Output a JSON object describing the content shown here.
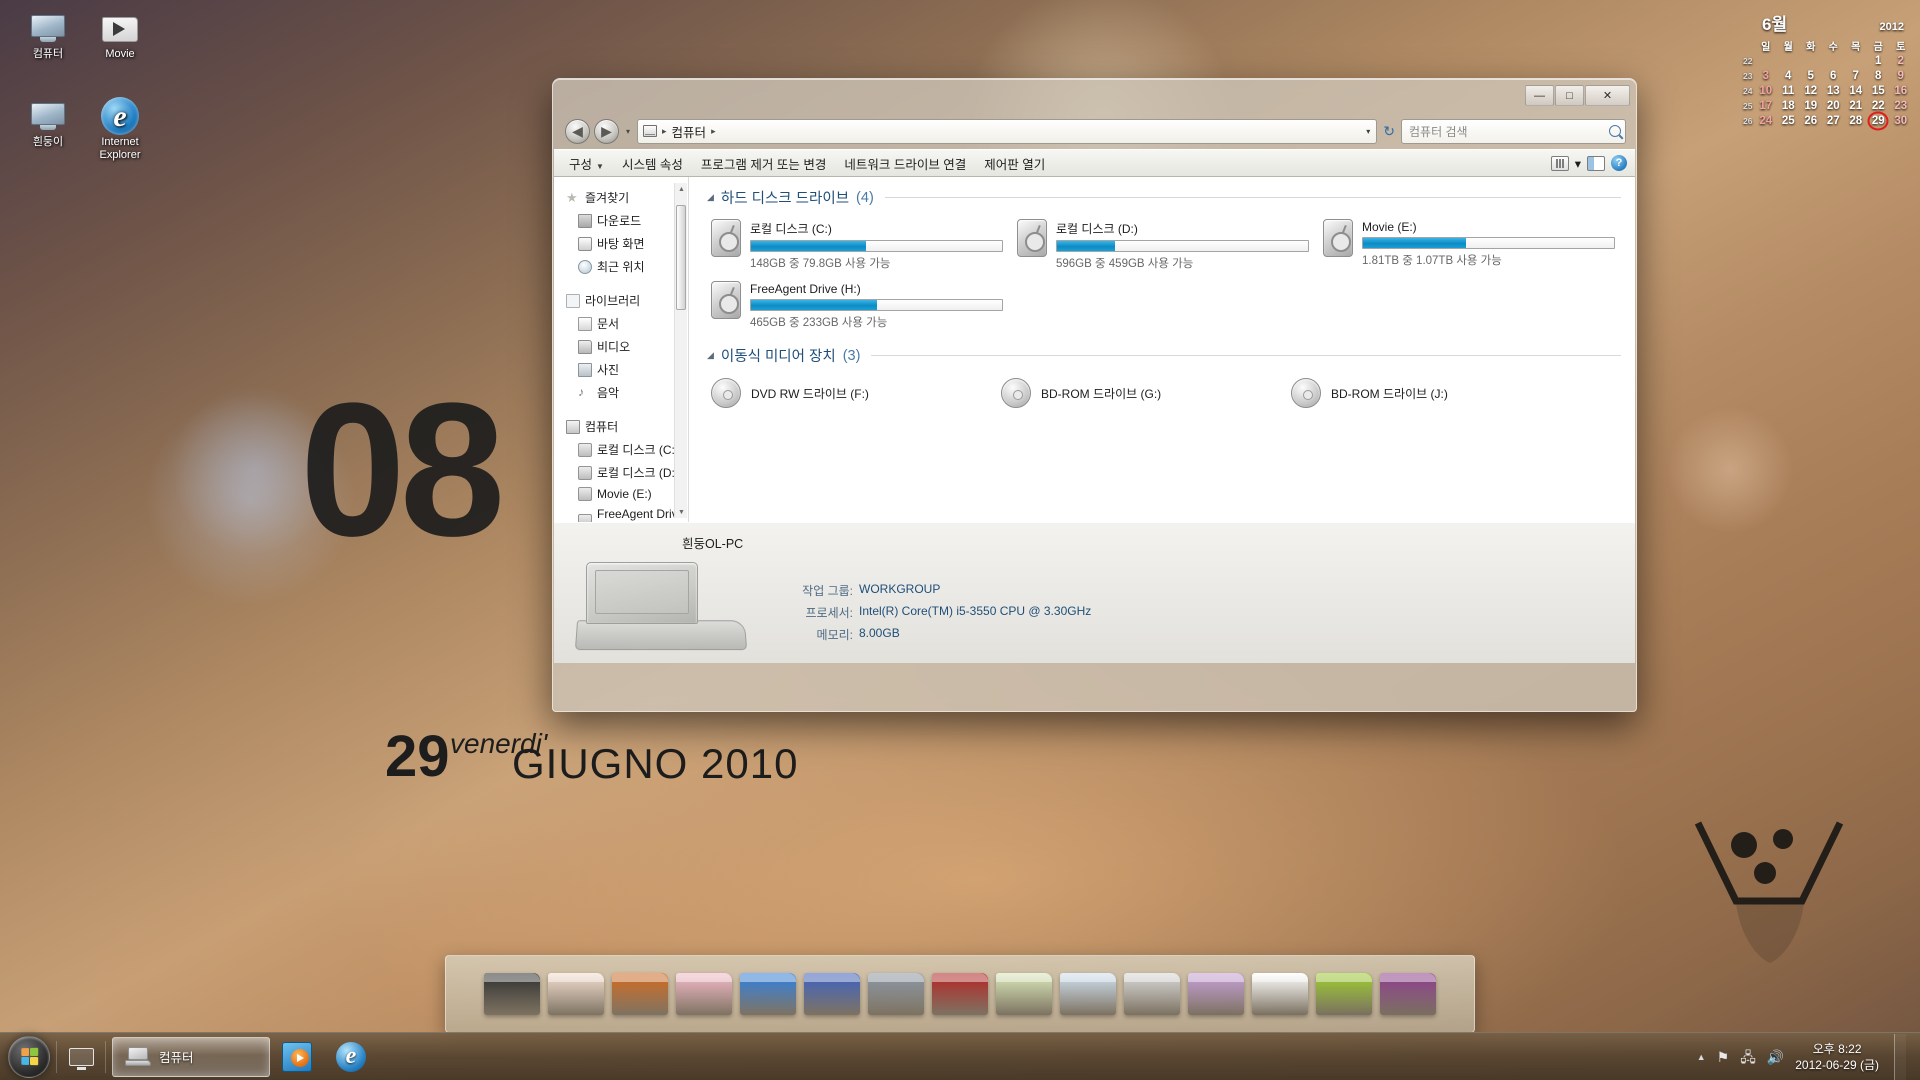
{
  "desktop": {
    "icons": [
      {
        "label": "컴퓨터",
        "icon": "computer-icon"
      },
      {
        "label": "Movie",
        "icon": "folder-movie-icon"
      },
      {
        "label": "흰둥이",
        "icon": "computer-icon"
      },
      {
        "label": "Internet Explorer",
        "icon": "internet-explorer-icon"
      }
    ],
    "wallpaper_text": {
      "time": "08",
      "day": "29",
      "weekday": "venerdi'",
      "month_year": "GIUGNO 2010"
    }
  },
  "calendar_gadget": {
    "month": "6월",
    "year": "2012",
    "weekday_headers": [
      "일",
      "월",
      "화",
      "수",
      "목",
      "금",
      "토"
    ],
    "week_numbers": [
      "22",
      "23",
      "24",
      "25",
      "26"
    ],
    "weeks": [
      [
        "",
        "",
        "",
        "",
        "",
        "1",
        "2"
      ],
      [
        "3",
        "4",
        "5",
        "6",
        "7",
        "8",
        "9"
      ],
      [
        "10",
        "11",
        "12",
        "13",
        "14",
        "15",
        "16"
      ],
      [
        "17",
        "18",
        "19",
        "20",
        "21",
        "22",
        "23"
      ],
      [
        "24",
        "25",
        "26",
        "27",
        "28",
        "29",
        "30"
      ]
    ],
    "today": "29",
    "today_highlight_color": "#e01c1c"
  },
  "window": {
    "title_buttons": {
      "minimize": "—",
      "maximize": "□",
      "close": "✕"
    },
    "nav": {
      "back_icon": "◀",
      "forward_icon": "▶",
      "history_caret": "▾",
      "address_icon": "computer-icon",
      "crumb_sep": "▸",
      "breadcrumb": [
        "컴퓨터"
      ],
      "address_caret": "▾",
      "refresh_icon": "↻",
      "search_placeholder": "컴퓨터 검색"
    },
    "commandbar": {
      "items": [
        {
          "label": "구성",
          "has_arrow": true
        },
        {
          "label": "시스템 속성",
          "has_arrow": false
        },
        {
          "label": "프로그램 제거 또는 변경",
          "has_arrow": false
        },
        {
          "label": "네트워크 드라이브 연결",
          "has_arrow": false
        },
        {
          "label": "제어판 열기",
          "has_arrow": false
        }
      ],
      "view_caret": "▾"
    },
    "navpane": {
      "groups": [
        {
          "label": "즐겨찾기",
          "icon": "star-icon",
          "items": [
            {
              "label": "다운로드",
              "icon": "downloads-icon"
            },
            {
              "label": "바탕 화면",
              "icon": "desktop-icon"
            },
            {
              "label": "최근 위치",
              "icon": "recent-places-icon"
            }
          ]
        },
        {
          "label": "라이브러리",
          "icon": "library-icon",
          "items": [
            {
              "label": "문서",
              "icon": "documents-icon"
            },
            {
              "label": "비디오",
              "icon": "videos-icon"
            },
            {
              "label": "사진",
              "icon": "pictures-icon"
            },
            {
              "label": "음악",
              "icon": "music-icon"
            }
          ]
        },
        {
          "label": "컴퓨터",
          "icon": "computer-icon",
          "items": [
            {
              "label": "로컬 디스크 (C:)",
              "icon": "drive-icon"
            },
            {
              "label": "로컬 디스크 (D:)",
              "icon": "drive-icon"
            },
            {
              "label": "Movie (E:)",
              "icon": "drive-icon"
            },
            {
              "label": "FreeAgent Drive (",
              "icon": "drive-icon"
            }
          ]
        }
      ]
    },
    "sections": [
      {
        "title": "하드 디스크 드라이브",
        "count": "(4)",
        "drives": [
          {
            "name": "로컬 디스크 (C:)",
            "sub": "148GB 중 79.8GB 사용 가능",
            "used_pct": 46
          },
          {
            "name": "로컬 디스크 (D:)",
            "sub": "596GB 중 459GB 사용 가능",
            "used_pct": 23
          },
          {
            "name": "Movie (E:)",
            "sub": "1.81TB 중 1.07TB 사용 가능",
            "used_pct": 41
          },
          {
            "name": "FreeAgent Drive (H:)",
            "sub": "465GB 중 233GB 사용 가능",
            "used_pct": 50
          }
        ]
      },
      {
        "title": "이동식 미디어 장치",
        "count": "(3)",
        "optical": [
          {
            "name": "DVD RW 드라이브 (F:)",
            "icon": "optical-drive-icon"
          },
          {
            "name": "BD-ROM 드라이브 (G:)",
            "icon": "optical-drive-icon"
          },
          {
            "name": "BD-ROM 드라이브 (J:)",
            "icon": "optical-drive-icon"
          }
        ]
      }
    ],
    "details": {
      "computer_name": "흰둥OL-PC",
      "fields": [
        {
          "label": "작업 그룹:",
          "value": "WORKGROUP"
        },
        {
          "label": "프로세서:",
          "value": "Intel(R) Core(TM) i5-3550 CPU @ 3.30GHz"
        },
        {
          "label": "메모리:",
          "value": "8.00GB"
        }
      ]
    },
    "accent_color": "#1f4e79",
    "progress_color": "#0e8bc4"
  },
  "dock": {
    "folders": [
      "#2e2e2e",
      "#f4ded0",
      "#d2691e",
      "#f4b9c8",
      "#2f7fe0",
      "#3b5fc0",
      "#8a96a3",
      "#b32222",
      "#d9e7b8",
      "#cfe0f0",
      "#d8d8d8",
      "#c79fd8",
      "#ffffff",
      "#9ccc2e",
      "#8e3d8e"
    ]
  },
  "taskbar": {
    "start_label": "start-orb",
    "show_desktop_icon": "monitor-icon",
    "items": [
      {
        "label": "컴퓨터",
        "icon": "computer-icon",
        "active": true
      },
      {
        "label": "",
        "icon": "windows-media-player-icon",
        "active": false
      },
      {
        "label": "",
        "icon": "internet-explorer-icon",
        "active": false
      }
    ],
    "tray": {
      "overflow_arrow": "▲",
      "icons": [
        "flag-icon",
        "network-icon",
        "volume-icon"
      ],
      "time": "오후 8:22",
      "date": "2012-06-29 (금)"
    }
  }
}
